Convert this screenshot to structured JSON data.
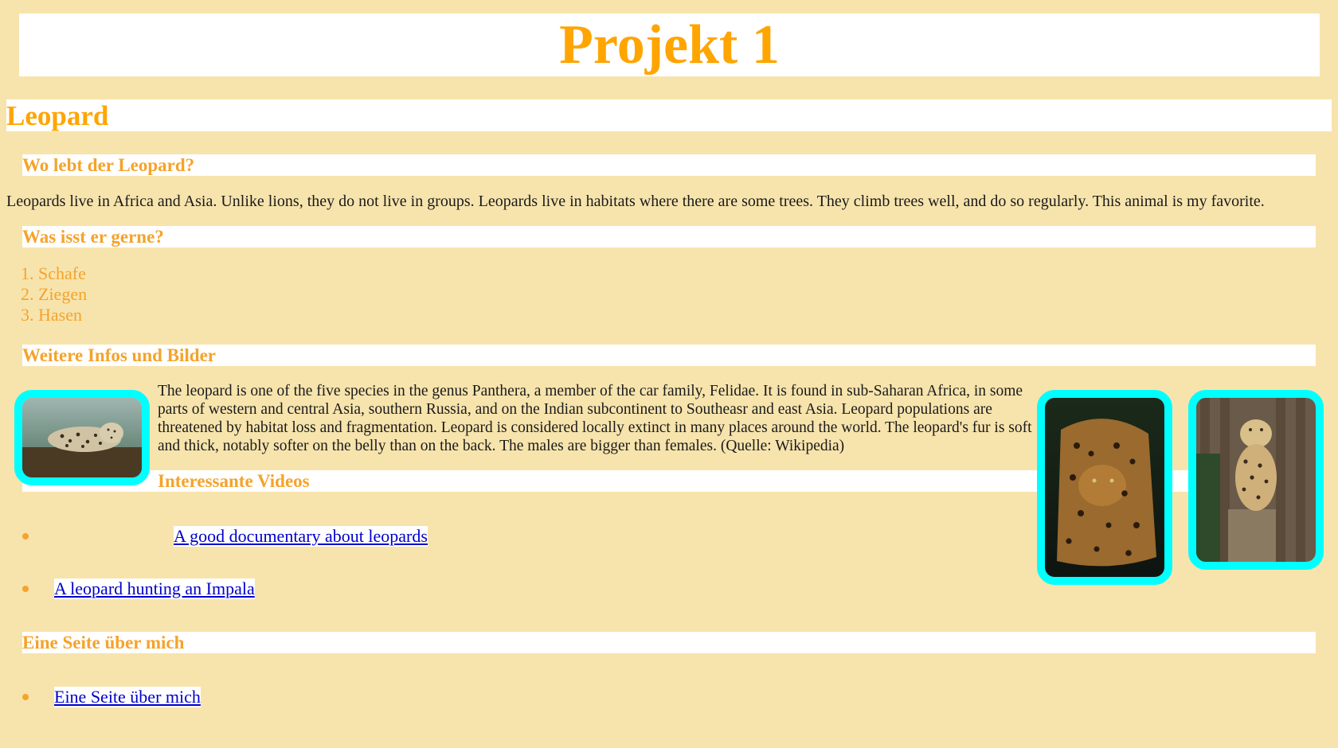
{
  "page": {
    "title": "Projekt 1",
    "animal_heading": "Leopard"
  },
  "sections": {
    "where": {
      "heading": "Wo lebt der Leopard?",
      "text": "Leopards live in Africa and Asia. Unlike lions, they do not live in groups. Leopards live in habitats where there are some trees. They climb trees well, and do so regularly. This animal is my favorite."
    },
    "food": {
      "heading": "Was isst er gerne?",
      "items": [
        "1. Schafe",
        "2. Ziegen",
        "3. Hasen"
      ]
    },
    "info": {
      "heading": "Weitere Infos und Bilder",
      "text": "The leopard is one of the five species in the genus Panthera, a member of the car family, Felidae. It is found in sub-Saharan Africa, in some parts of western and central Asia, southern Russia, and on the Indian subcontinent to Southeasr and east Asia. Leopard populations are threatened by habitat loss and fragmentation. Leopard is considered locally extinct in many places around the world. The leopard's fur is soft and thick, notably softer on the belly than on the back. The males are bigger than females. (Quelle: Wikipedia)"
    },
    "videos": {
      "heading": "Interessante Videos",
      "links": [
        "A good documentary about leopards",
        "A leopard hunting an Impala"
      ]
    },
    "about": {
      "heading": "Eine Seite über mich",
      "links": [
        "Eine Seite über mich"
      ]
    }
  },
  "colors": {
    "background": "#f7e4ad",
    "heading": "#ffa500",
    "image_border": "#00ffff",
    "link": "#0000cc"
  },
  "images": [
    "leopard-lying-on-branch-photo",
    "leopard-stalking-dark-photo",
    "leopard-sitting-on-stump-photo"
  ]
}
